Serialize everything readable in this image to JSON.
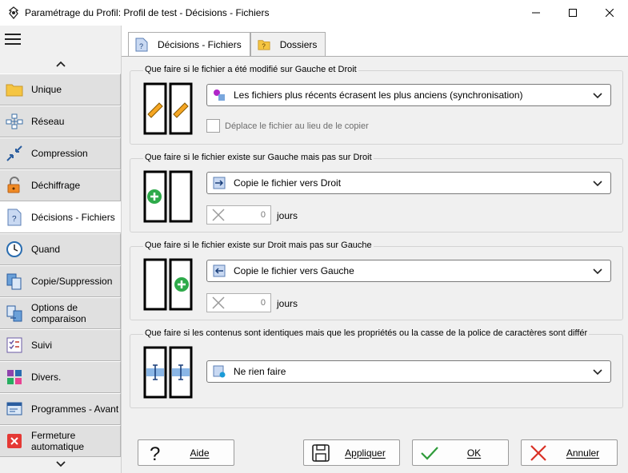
{
  "window": {
    "title": "Paramétrage du Profil: Profil de test - Décisions - Fichiers"
  },
  "sidebar": {
    "items": [
      {
        "label": "Unique",
        "icon": "folder-icon"
      },
      {
        "label": "Réseau",
        "icon": "network-icon"
      },
      {
        "label": "Compression",
        "icon": "compress-icon"
      },
      {
        "label": "Déchiffrage",
        "icon": "unlock-icon"
      },
      {
        "label": "Décisions - Fichiers",
        "icon": "file-question-icon"
      },
      {
        "label": "Quand",
        "icon": "clock-icon"
      },
      {
        "label": "Copie/Suppression",
        "icon": "copy-icon"
      },
      {
        "label": "Options de comparaison",
        "icon": "compare-icon"
      },
      {
        "label": "Suivi",
        "icon": "checklist-icon"
      },
      {
        "label": "Divers.",
        "icon": "misc-icon"
      },
      {
        "label": "Programmes - Avant",
        "icon": "program-icon"
      },
      {
        "label": "Fermeture automatique",
        "icon": "close-red-icon"
      }
    ]
  },
  "tabs": [
    {
      "label": "Décisions - Fichiers"
    },
    {
      "label": "Dossiers"
    }
  ],
  "groups": {
    "modified": {
      "legend": "Que faire si le fichier a été modifié sur Gauche et Droit",
      "select_value": "Les fichiers plus récents écrasent les plus anciens (synchronisation)",
      "checkbox_label": "Déplace le fichier au lieu de le copier"
    },
    "left_only": {
      "legend": "Que faire si le fichier existe sur Gauche mais pas sur Droit",
      "select_value": "Copie le fichier vers Droit",
      "spin_value": "0",
      "unit": "jours"
    },
    "right_only": {
      "legend": "Que faire si le fichier existe sur Droit mais pas sur Gauche",
      "select_value": "Copie le fichier vers Gauche",
      "spin_value": "0",
      "unit": "jours"
    },
    "identical": {
      "legend": "Que faire si les contenus sont identiques mais que les propriétés ou la casse de la police de caractères sont différ",
      "select_value": "Ne rien faire"
    }
  },
  "footer": {
    "help": "Aide",
    "apply": "Appliquer",
    "ok": "OK",
    "cancel": "Annuler"
  }
}
